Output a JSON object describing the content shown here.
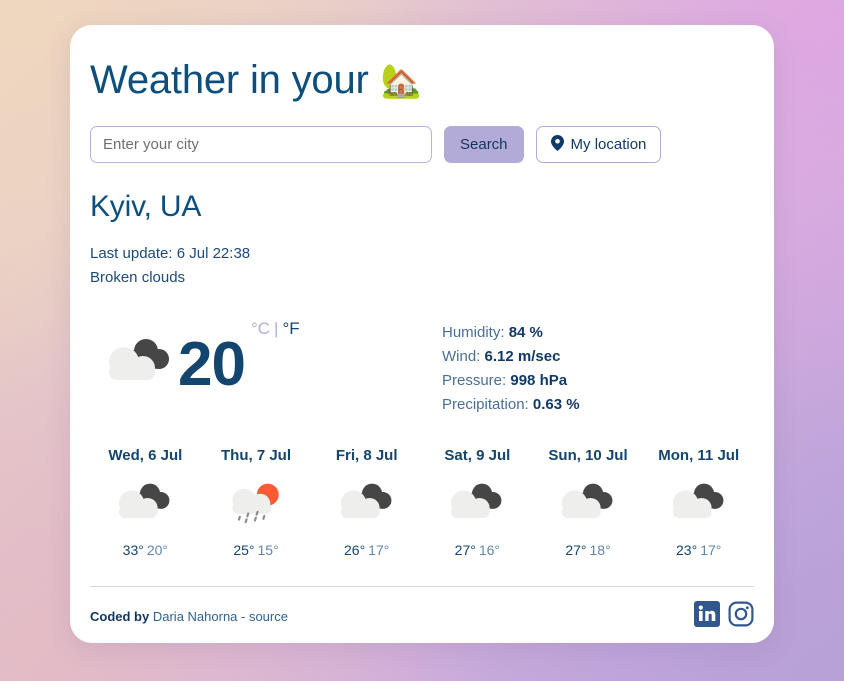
{
  "header": {
    "title": "Weather in your",
    "emoji": "🏡",
    "emoji_name": "house-with-garden-emoji"
  },
  "search": {
    "placeholder": "Enter your city",
    "value": "",
    "search_label": "Search",
    "location_label": "My location",
    "location_icon": "map-pin-icon"
  },
  "current": {
    "city": "Kyiv, UA",
    "last_update": "Last update: 6 Jul 22:38",
    "description": "Broken clouds",
    "temperature": "20",
    "unit_celsius": "°C",
    "unit_separator": "|",
    "unit_fahrenheit": "°F",
    "icon": "broken-clouds-icon",
    "details": [
      {
        "label": "Humidity:",
        "value": "84 %"
      },
      {
        "label": "Wind:",
        "value": "6.12 m/sec"
      },
      {
        "label": "Pressure:",
        "value": "998 hPa"
      },
      {
        "label": "Precipitation:",
        "value": "0.63 %"
      }
    ]
  },
  "forecast": [
    {
      "day": "Wed, 6 Jul",
      "icon": "broken-clouds-icon",
      "max": "33°",
      "min": "20°"
    },
    {
      "day": "Thu, 7 Jul",
      "icon": "sun-behind-rain-cloud-icon",
      "max": "25°",
      "min": "15°"
    },
    {
      "day": "Fri, 8 Jul",
      "icon": "broken-clouds-icon",
      "max": "26°",
      "min": "17°"
    },
    {
      "day": "Sat, 9 Jul",
      "icon": "broken-clouds-icon",
      "max": "27°",
      "min": "16°"
    },
    {
      "day": "Sun, 10 Jul",
      "icon": "broken-clouds-icon",
      "max": "27°",
      "min": "18°"
    },
    {
      "day": "Mon, 11 Jul",
      "icon": "broken-clouds-icon",
      "max": "23°",
      "min": "17°"
    }
  ],
  "footer": {
    "credit_prefix": "Coded by",
    "credit_link": "Daria Nahorna - source",
    "linkedin_icon": "linkedin-icon",
    "instagram_icon": "instagram-icon"
  },
  "colors": {
    "brand_navy": "#0d4e7d",
    "accent_purple": "#b2abd8",
    "sun_orange": "#fa5b32",
    "cloud_light": "#ededed",
    "cloud_dark": "#464646",
    "social_blue": "#32578f"
  }
}
